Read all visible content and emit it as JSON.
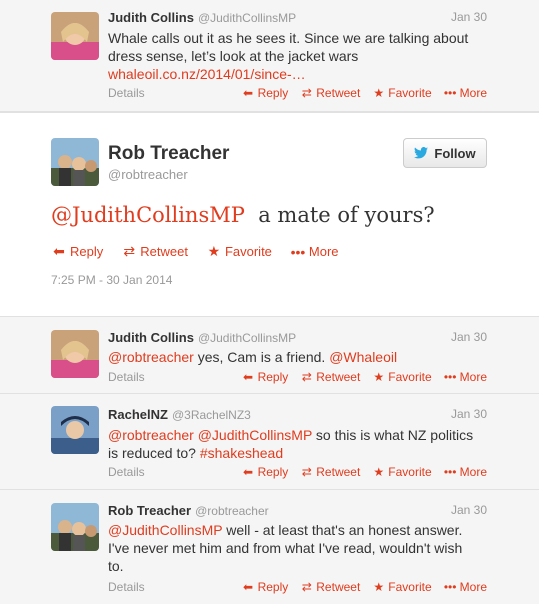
{
  "t1": {
    "name": "Judith Collins",
    "handle": "@JudithCollinsMP",
    "date": "Jan 30",
    "line1": "Whale calls out it as he sees it. Since we are talking about",
    "line2": "dress sense, let’s look at the jacket wars",
    "link": "whaleoil.co.nz/2014/01/since-…",
    "details": "Details"
  },
  "actions": {
    "reply": "Reply",
    "retweet": "Retweet",
    "favorite": "Favorite",
    "more": "More"
  },
  "main": {
    "name": "Rob Treacher",
    "handle": "@robtreacher",
    "follow": "Follow",
    "mention": "@JudithCollinsMP",
    "text": "a mate of yours?",
    "timestamp": "7:25 PM - 30 Jan 2014"
  },
  "t2": {
    "name": "Judith Collins",
    "handle": "@JudithCollinsMP",
    "date": "Jan 30",
    "mention1": "@robtreacher",
    "text": " yes, Cam is a friend. ",
    "mention2": "@Whaleoil",
    "details": "Details"
  },
  "t3": {
    "name": "RachelNZ",
    "handle": "@3RachelNZ3",
    "date": "Jan 30",
    "mention1": "@robtreacher",
    "mention2": "@JudithCollinsMP",
    "text1": " so this is what NZ politics",
    "text2": "is reduced to? ",
    "hashtag": "#shakeshead",
    "details": "Details"
  },
  "t4": {
    "name": "Rob Treacher",
    "handle": "@robtreacher",
    "date": "Jan 30",
    "mention": "@JudithCollinsMP",
    "text1": " well - at least that's an honest answer.",
    "text2": "I've never met him and from what I've read, wouldn't wish",
    "text3": "to.",
    "details": "Details"
  },
  "colors": {
    "accent": "#e03c1e",
    "muted": "#999999",
    "text": "#333333"
  }
}
